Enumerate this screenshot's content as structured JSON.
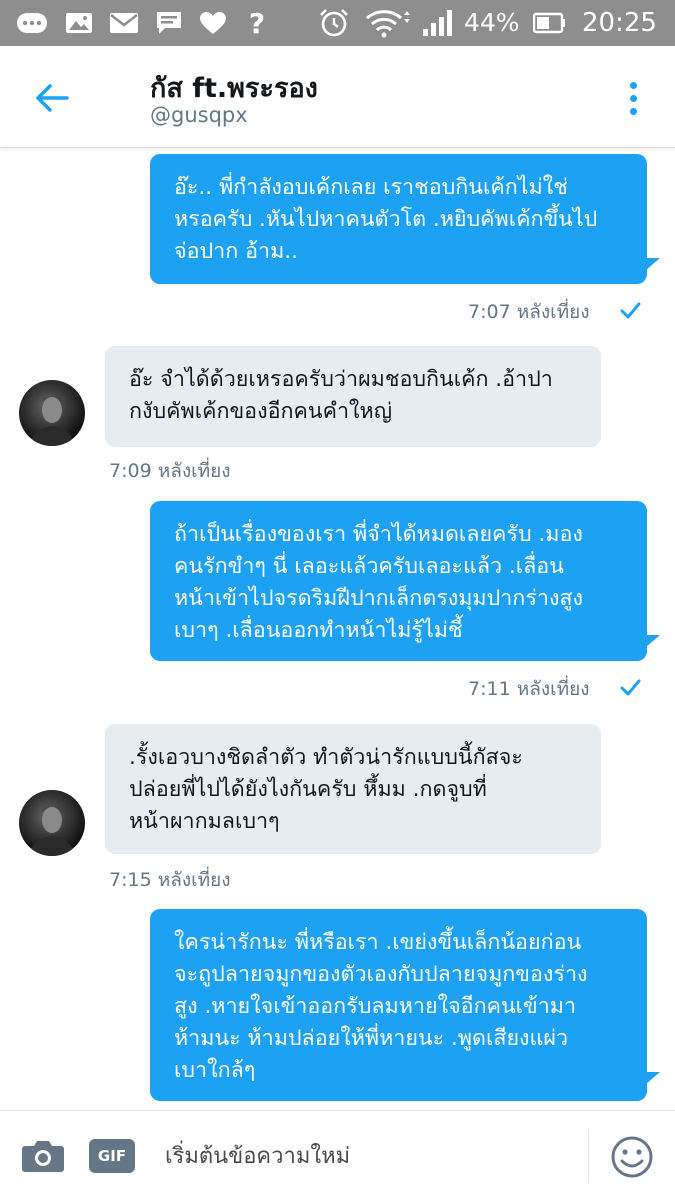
{
  "status_bar": {
    "battery_percent": "44%",
    "time": "20:25",
    "icons": [
      "chat-dots-icon",
      "image-icon",
      "mail-icon",
      "message-icon",
      "heart-icon",
      "question-icon",
      "alarm-icon",
      "wifi-icon",
      "signal-icon",
      "battery-icon"
    ]
  },
  "header": {
    "title": "กัส ft.พระรอง",
    "handle": "@gusqpx",
    "accent_color": "#1da1f2"
  },
  "messages": [
    {
      "direction": "outgoing",
      "text": "อ๊ะ.. พี่กำลังอบเค้กเลย เราชอบกินเค้กไม่ใช่\nหรอครับ .หันไปหาคนตัวโต .หยิบคัพเค้กขึ้นไป\nจ่อปาก อ้าม..",
      "time": "7:07 หลังเที่ยง"
    },
    {
      "direction": "incoming",
      "text": "อ๊ะ จำได้ด้วยเหรอครับว่าผมชอบกินเค้ก .อ้าปา\nกงับคัพเค้กของอีกคนคำใหญ่",
      "time": "7:09 หลังเที่ยง"
    },
    {
      "direction": "outgoing",
      "text": "ถ้าเป็นเรื่องของเรา พี่จำได้หมดเลยครับ .มอง\nคนรักขำๆ นี่ เลอะแล้วครับเลอะแล้ว .เลื่อน\nหน้าเข้าไปจรดริมฝีปากเล็กตรงมุมปากร่างสูง\nเบาๆ .เลื่อนออกทำหน้าไม่รู้ไม่ชี้",
      "time": "7:11 หลังเที่ยง"
    },
    {
      "direction": "incoming",
      "text": ".รั้งเอวบางชิดลำตัว ทำตัวน่ารักแบบนี้กัสจะ\nปล่อยพี่ไปได้ยังไงกันครับ หึ้มม .กดจูบที่\nหน้าผากมลเบาๆ",
      "time": "7:15 หลังเที่ยง"
    },
    {
      "direction": "outgoing",
      "text": "ใครน่ารักนะ พี่หรือเรา .เขย่งขึ้นเล็กน้อยก่อน\nจะถูปลายจมูกของตัวเองกับปลายจมูกของร่าง\nสูง .หายใจเข้าออกรับลมหายใจอีกคนเข้ามา\nห้ามนะ ห้ามปล่อยให้พี่หายนะ .พูดเสียงแผ่ว\nเบาใกล้ๆ",
      "time": ""
    }
  ],
  "compose": {
    "gif_label": "GIF",
    "placeholder": "เริ่มต้นข้อความใหม่"
  }
}
